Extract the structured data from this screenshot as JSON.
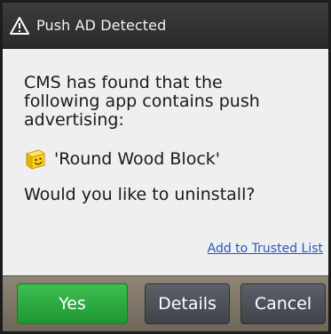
{
  "dialog": {
    "title": "Push AD Detected",
    "title_icon": "warning-triangle-icon",
    "message": "CMS has found that the following app contains push advertising:",
    "app_icon": "smiley-block-icon",
    "app_name": "'Round Wood Block'",
    "question": "Would you like to uninstall?",
    "trusted_link": "Add to Trusted List"
  },
  "buttons": {
    "yes": "Yes",
    "details": "Details",
    "cancel": "Cancel"
  },
  "colors": {
    "title_bar": "#2f2f2f",
    "body": "#efefef",
    "link": "#2a56c6",
    "yes_button": "#2aa83f",
    "secondary_button": "#4a4f57",
    "button_bar": "#7d7568"
  }
}
